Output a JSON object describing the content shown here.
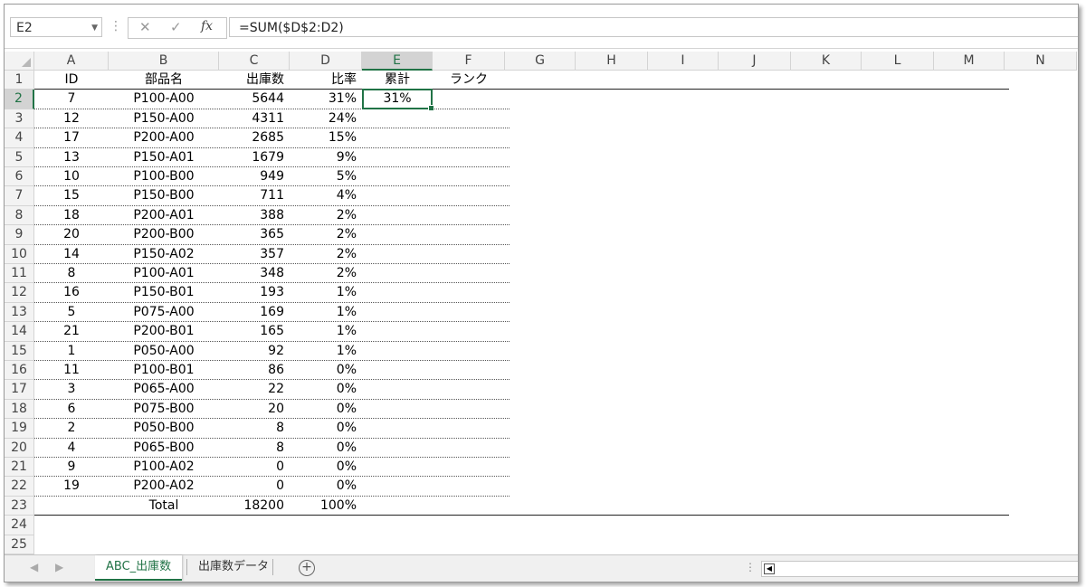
{
  "formula_bar": {
    "name_box": "E2",
    "cancel_glyph": "✕",
    "enter_glyph": "✓",
    "fx_glyph": "fx",
    "formula": "=SUM($D$2:D2)"
  },
  "columns": [
    "A",
    "B",
    "C",
    "D",
    "E",
    "F",
    "G",
    "H",
    "I",
    "J",
    "K",
    "L",
    "M",
    "N"
  ],
  "selected_column": "E",
  "rows": [
    "1",
    "2",
    "3",
    "4",
    "5",
    "6",
    "7",
    "8",
    "9",
    "10",
    "11",
    "12",
    "13",
    "14",
    "15",
    "16",
    "17",
    "18",
    "19",
    "20",
    "21",
    "22",
    "23",
    "24",
    "25"
  ],
  "selected_row": "2",
  "table": {
    "headers": [
      "ID",
      "部品名",
      "出庫数",
      "比率",
      "累計",
      "ランク"
    ],
    "data": [
      [
        "7",
        "P100-A00",
        "5644",
        "31%",
        "31%",
        ""
      ],
      [
        "12",
        "P150-A00",
        "4311",
        "24%",
        "",
        ""
      ],
      [
        "17",
        "P200-A00",
        "2685",
        "15%",
        "",
        ""
      ],
      [
        "13",
        "P150-A01",
        "1679",
        "9%",
        "",
        ""
      ],
      [
        "10",
        "P100-B00",
        "949",
        "5%",
        "",
        ""
      ],
      [
        "15",
        "P150-B00",
        "711",
        "4%",
        "",
        ""
      ],
      [
        "18",
        "P200-A01",
        "388",
        "2%",
        "",
        ""
      ],
      [
        "20",
        "P200-B00",
        "365",
        "2%",
        "",
        ""
      ],
      [
        "14",
        "P150-A02",
        "357",
        "2%",
        "",
        ""
      ],
      [
        "8",
        "P100-A01",
        "348",
        "2%",
        "",
        ""
      ],
      [
        "16",
        "P150-B01",
        "193",
        "1%",
        "",
        ""
      ],
      [
        "5",
        "P075-A00",
        "169",
        "1%",
        "",
        ""
      ],
      [
        "21",
        "P200-B01",
        "165",
        "1%",
        "",
        ""
      ],
      [
        "1",
        "P050-A00",
        "92",
        "1%",
        "",
        ""
      ],
      [
        "11",
        "P100-B01",
        "86",
        "0%",
        "",
        ""
      ],
      [
        "3",
        "P065-A00",
        "22",
        "0%",
        "",
        ""
      ],
      [
        "6",
        "P075-B00",
        "20",
        "0%",
        "",
        ""
      ],
      [
        "2",
        "P050-B00",
        "8",
        "0%",
        "",
        ""
      ],
      [
        "4",
        "P065-B00",
        "8",
        "0%",
        "",
        ""
      ],
      [
        "9",
        "P100-A02",
        "0",
        "0%",
        "",
        ""
      ],
      [
        "19",
        "P200-A02",
        "0",
        "0%",
        "",
        ""
      ]
    ],
    "total": [
      "",
      "Total",
      "18200",
      "100%",
      "",
      ""
    ]
  },
  "sheet_tabs": [
    {
      "label": "ABC_出庫数",
      "active": true
    },
    {
      "label": "出庫数データ",
      "active": false
    }
  ],
  "nav_icons": [
    "chevron-left-icon",
    "chevron-right-icon",
    "add-sheet-icon"
  ],
  "accent_color": "#217346"
}
